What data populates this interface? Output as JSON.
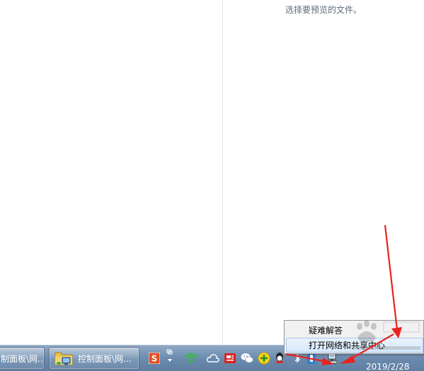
{
  "preview": {
    "message": "选择要预览的文件。"
  },
  "taskbar": {
    "buttons": [
      {
        "label": "制面板\\网..."
      },
      {
        "label": "控制面板\\网..."
      }
    ],
    "clock": {
      "date": "2019/2/28"
    }
  },
  "context_menu": {
    "items": [
      {
        "label": "疑难解答"
      },
      {
        "label": "打开网络和共享中心"
      }
    ]
  },
  "colors": {
    "annotation_arrow": "#e8231f",
    "taskbar": "#6787ab",
    "menu_highlight": "#d7e8fb"
  },
  "icons": [
    "folder-network-icon",
    "sogou-ime-icon",
    "ime-toggle-icon",
    "wifi-icon",
    "cloud-icon",
    "news-icon",
    "wechat-icon",
    "add-icon",
    "qq-icon",
    "bluetooth-icon",
    "ime-icon",
    "network-icon",
    "baidu-watermark-icon"
  ]
}
